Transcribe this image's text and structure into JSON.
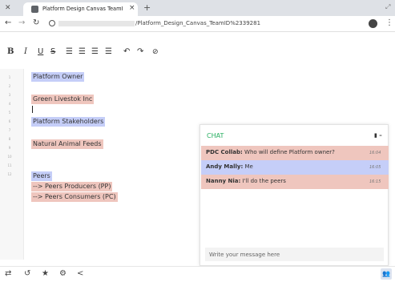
{
  "browser": {
    "tab_title": "Platform Design Canvas TeamI",
    "url_path": "/Platform_Design_Canvas_TeamID%2339281"
  },
  "editor": {
    "line_numbers": [
      "1",
      "2",
      "3",
      "4",
      "5",
      "6",
      "7",
      "8",
      "9",
      "10",
      "11",
      "12"
    ],
    "lines": [
      {
        "text": "Platform Owner",
        "highlight": "blue"
      },
      {
        "text": "Green Livestok Inc",
        "highlight": "red"
      },
      {
        "text": "Platform Stakeholders",
        "highlight": "blue"
      },
      {
        "text": "Natural Animal Feeds",
        "highlight": "red"
      },
      {
        "text": "Peers",
        "highlight": "blue"
      },
      {
        "text": "--> Peers Producers (PP)",
        "highlight": "red"
      },
      {
        "text": "--> Peers Consumers (PC)",
        "highlight": "red"
      }
    ]
  },
  "chat": {
    "title": "CHAT",
    "messages": [
      {
        "author": "PDC Collab:",
        "text": "Who will define Platform owner?",
        "time": "16:04",
        "color": "#efc6be"
      },
      {
        "author": "Andy Mally:",
        "text": "Me",
        "time": "16:05",
        "color": "#c5cef8"
      },
      {
        "author": "Nanny Nia:",
        "text": "I'll do the peers",
        "time": "16:15",
        "color": "#efc6be"
      }
    ],
    "input_placeholder": "Write your message here"
  },
  "colors": {
    "owner_highlight": "#c5cef8",
    "stakeholder_highlight": "#efc6be",
    "chat_title": "#27ae60"
  }
}
